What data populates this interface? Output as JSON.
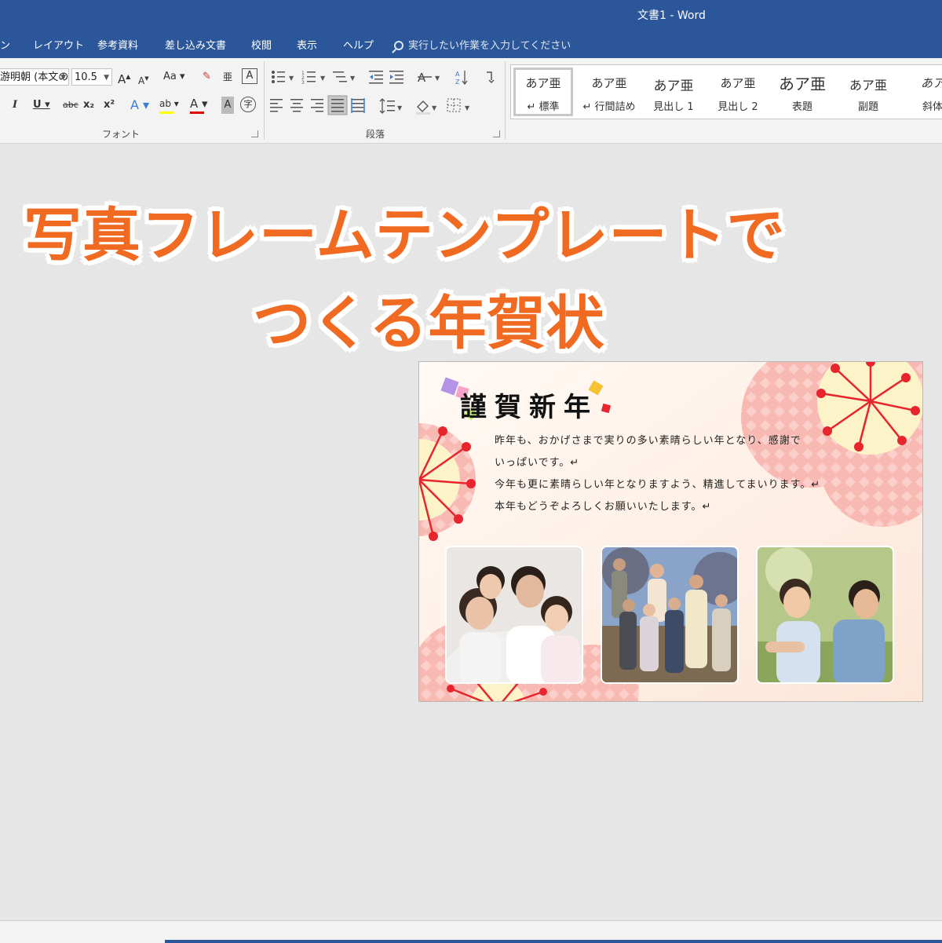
{
  "window": {
    "title": "文書1  -  Word"
  },
  "menu": {
    "tabs": [
      "ン",
      "レイアウト",
      "参考資料",
      "差し込み文書",
      "校閲",
      "表示",
      "ヘルプ"
    ],
    "search_hint": "実行したい作業を入力してください"
  },
  "ribbon": {
    "font_name": "游明朝 (本文の",
    "font_size": "10.5",
    "grow_label": "A",
    "shrink_label": "A",
    "case_label": "Aa",
    "italic": "I",
    "underline": "U",
    "strike": "abc",
    "subscript": "x₂",
    "superscript": "x²",
    "text_effect": "A",
    "highlight": "ab",
    "font_color": "A",
    "char_shade": "A",
    "enclose": "字",
    "phonetic": "亜",
    "border_char": "A",
    "font_group": "フォント",
    "paragraph_group": "段落",
    "highlight_color": "#ffff00",
    "font_color_value": "#e00000"
  },
  "styles": [
    {
      "sample": "あア亜",
      "name": "↵ 標準"
    },
    {
      "sample": "あア亜",
      "name": "↵ 行間詰め"
    },
    {
      "sample": "あア亜",
      "name": "見出し 1"
    },
    {
      "sample": "あア亜",
      "name": "見出し 2"
    },
    {
      "sample": "あア亜",
      "name": "表題"
    },
    {
      "sample": "あア亜",
      "name": "副題"
    },
    {
      "sample": "あア",
      "name": "斜体"
    }
  ],
  "headline": {
    "line1": "写真フレームテンプレートで",
    "line2": "つくる年賀状",
    "color": "#f06a22"
  },
  "card": {
    "title": "謹賀新年",
    "message": [
      "昨年も、おかげさまで実りの多い素晴らしい年となり、感謝で",
      "いっぱいです。↵",
      "今年も更に素晴らしい年となりますよう、精進してまいります。↵",
      "本年もどうぞよろしくお願いいたします。↵"
    ],
    "accent_red": "#e8242c",
    "blossom_pink": "#f9c4bd"
  }
}
